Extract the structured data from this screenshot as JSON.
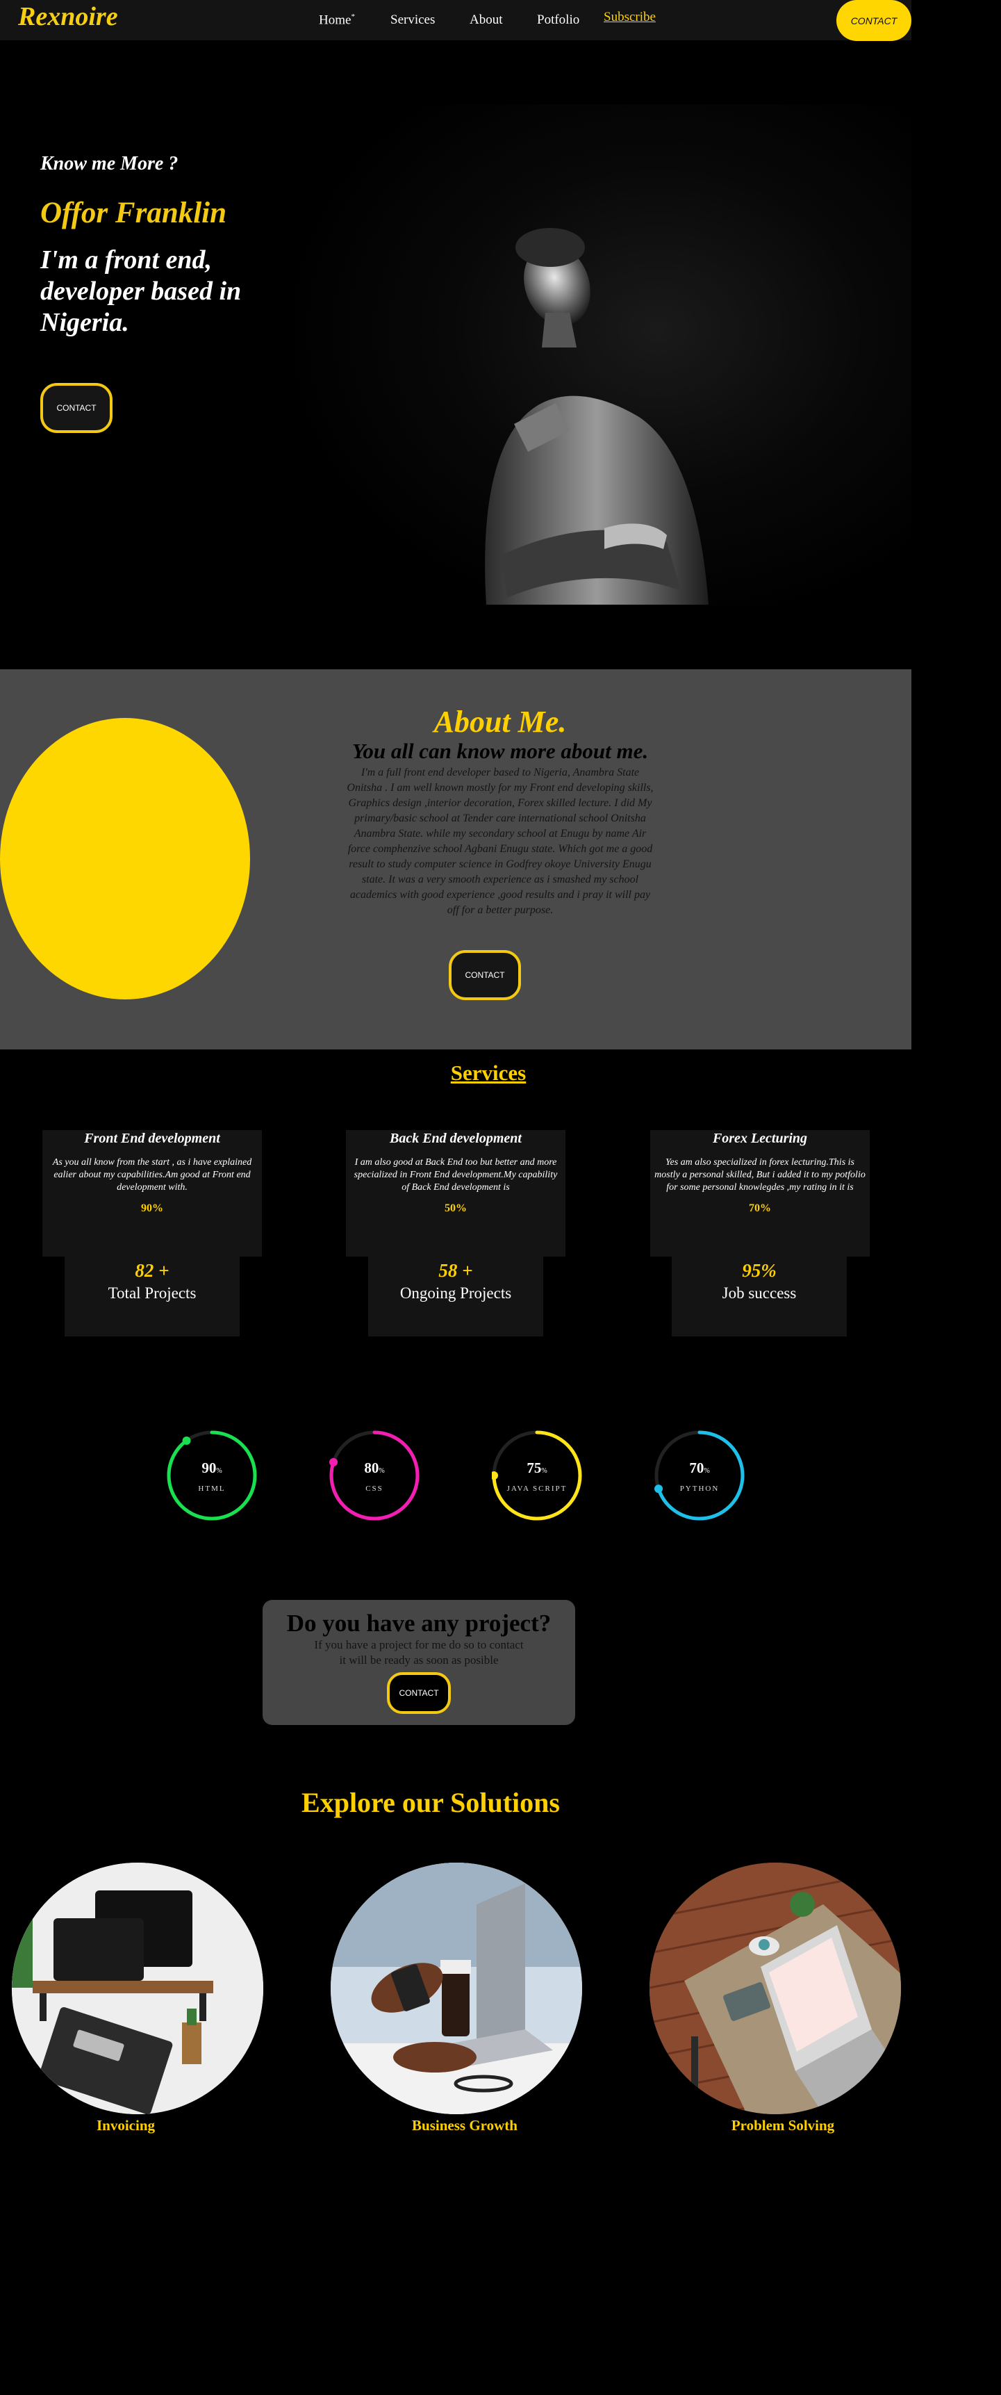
{
  "nav": {
    "logo": "Rexnoire",
    "links": [
      "Home",
      "Services",
      "About",
      "Potfolio"
    ],
    "home_marker": "*",
    "subscribe": "Subscribe",
    "contact": "CONTACT"
  },
  "hero": {
    "kicker": "Know me More ?",
    "name": "Offor Franklin",
    "tagline": "I'm a front end, developer based in Nigeria.",
    "contact": "CONTACT"
  },
  "about": {
    "title": "About Me.",
    "subtitle": "You all can know more about me.",
    "body": "I'm a full front end developer based to Nigeria, Anambra State Onitsha . I am well known mostly for my Front end developing skills, Graphics design ,interior decoration, Forex skilled lecture. I did My primary/basic school at Tender care international school Onitsha Anambra State. while my secondary school at Enugu by name Air force comphenzive school Agbani Enugu state. Which got me a good result to study computer science in Godfrey okoye University Enugu state. It was a very smooth experience as i smashed my school academics with good experience ,good results and i pray it will pay off for a better purpose.",
    "contact": "CONTACT"
  },
  "services": {
    "heading": "Services",
    "cards": [
      {
        "title": "Front End development",
        "desc": "As you all know from the start , as i have explained ealier about my capabilities.Am good at Front end development with.",
        "pct": "90%"
      },
      {
        "title": "Back End development",
        "desc": "I am also good at Back End too but better and more specialized in Front End development.My capability of Back End development is",
        "pct": "50%"
      },
      {
        "title": "Forex Lecturing",
        "desc": "Yes am also specialized in forex lecturing.This is mostly a personal skilled, But i added it to my potfolio for some personal knowlegdes ,my rating in it is",
        "pct": "70%"
      }
    ],
    "stats": [
      {
        "num": "82 +",
        "label": "Total Projects"
      },
      {
        "num": "58 +",
        "label": "Ongoing Projects"
      },
      {
        "num": "95%",
        "label": "Job success"
      }
    ]
  },
  "skills": [
    {
      "value": "90",
      "unit": "%",
      "name": "HTML",
      "fraction": 0.9,
      "color": "#19e04f"
    },
    {
      "value": "80",
      "unit": "%",
      "name": "CSS",
      "fraction": 0.8,
      "color": "#f41fb2"
    },
    {
      "value": "75",
      "unit": "%",
      "name": "JAVA SCRIPT",
      "fraction": 0.75,
      "color": "#ffe41a"
    },
    {
      "value": "70",
      "unit": "%",
      "name": "PYTHON",
      "fraction": 0.7,
      "color": "#1ec0ea"
    }
  ],
  "project": {
    "title": "Do you have any project?",
    "line1": "If you have a project for me do so to contact",
    "line2": "it will be ready as soon as posible",
    "contact": "CONTACT"
  },
  "solutions": {
    "heading": "Explore our Solutions",
    "items": [
      {
        "label": "Invoicing"
      },
      {
        "label": "Business Growth"
      },
      {
        "label": "Problem Solving"
      }
    ]
  }
}
